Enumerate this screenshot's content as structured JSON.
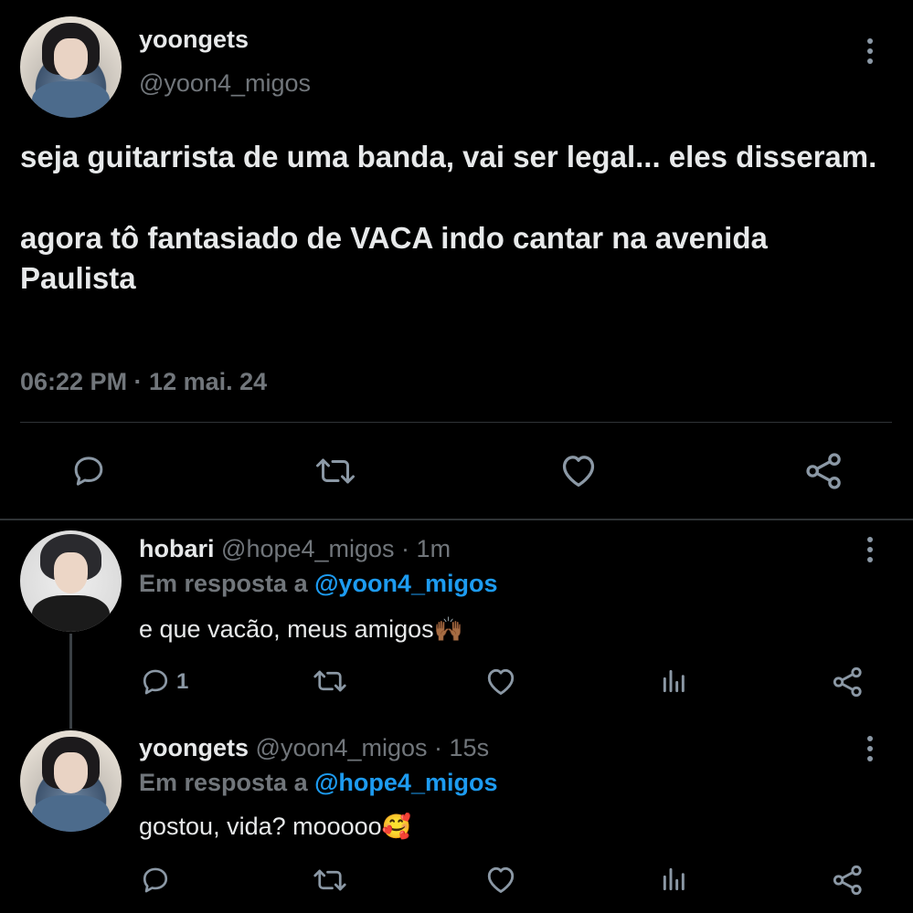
{
  "main_tweet": {
    "display_name": "yoongets",
    "handle": "@yoon4_migos",
    "text_line1": "seja guitarrista de uma banda, vai ser legal... eles disseram.",
    "text_line2": "agora tô fantasiado de VACA indo cantar na avenida Paulista",
    "timestamp": "06:22 PM · 12 mai. 24",
    "actions": [
      "reply-icon",
      "retweet-icon",
      "like-icon",
      "share-icon"
    ]
  },
  "replies": [
    {
      "display_name": "hobari",
      "handle_time": "@hope4_migos · 1m",
      "replying_prefix": "Em resposta a",
      "replying_to": "@yoon4_migos",
      "text": "e que vacão, meus amigos",
      "emoji": "🙌🏾",
      "reply_count": "1"
    },
    {
      "display_name": "yoongets",
      "handle_time": "@yoon4_migos · 15s",
      "replying_prefix": "Em resposta a",
      "replying_to": "@hope4_migos",
      "text": "gostou, vida? mooooo",
      "emoji": "🥰",
      "reply_count": ""
    }
  ],
  "colors": {
    "background": "#000000",
    "text_primary": "#e7e9ea",
    "text_secondary": "#71767b",
    "accent_link": "#1d9bf0",
    "icon": "#8b98a5",
    "divider": "#2f3336"
  }
}
